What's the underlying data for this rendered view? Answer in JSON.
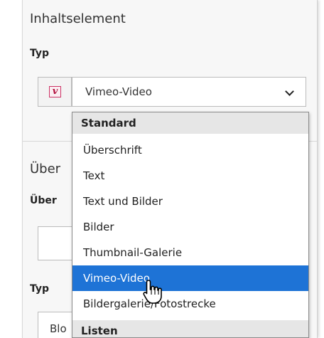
{
  "form": {
    "section1_title": "Inhaltselement",
    "type_label": "Typ",
    "select_value": "Vimeo-Video",
    "section2_title": "Über",
    "section2_field_label": "Über",
    "type_label_2": "Typ",
    "input2_value_partial": "Blo"
  },
  "icons": {
    "vimeo_icon": "vimeo-icon",
    "vimeo_glyph": "v",
    "chevron": "chevron-down-icon",
    "cursor": "hand-pointer-cursor"
  },
  "dropdown": {
    "groups": [
      "Standard",
      "Listen"
    ],
    "items": [
      "Überschrift",
      "Text",
      "Text und Bilder",
      "Bilder",
      "Thumbnail-Galerie",
      "Vimeo-Video",
      "Bildergalerie/Fotostrecke"
    ],
    "selected": "Vimeo-Video"
  },
  "colors": {
    "selection": "#1e73d6",
    "vimeo_brand": "#b3123f",
    "group_bg": "#e6e6e6"
  }
}
